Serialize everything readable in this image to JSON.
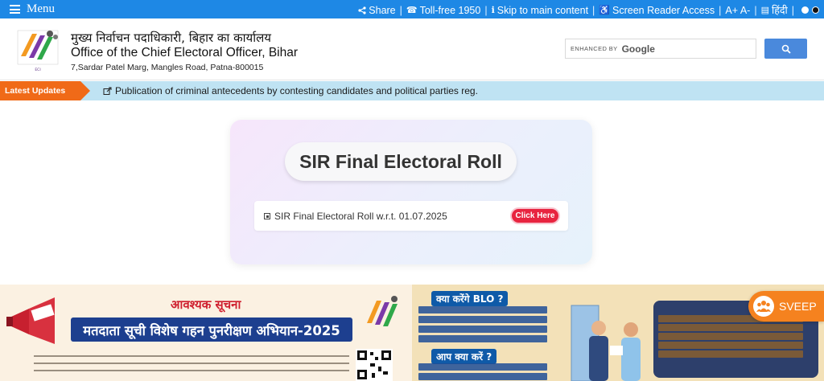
{
  "topbar": {
    "menu_label": "Menu",
    "share": "Share",
    "tollfree": "Toll-free 1950",
    "skip": "Skip to main content",
    "screen_reader": "Screen Reader Access",
    "text_size": "A+ A-",
    "language": "हिंदी",
    "bg_color": "#1e88e5"
  },
  "header": {
    "hindi_title": "मुख्य निर्वाचन पदाधिकारी, बिहार का कार्यालय",
    "english_title": "Office of the Chief Electoral Officer, Bihar",
    "address": "7,Sardar Patel Marg, Mangles Road, Patna-800015",
    "search_enhanced": "ENHANCED BY",
    "search_brand": "Google",
    "search_placeholder": ""
  },
  "updates": {
    "label": "Latest Updates",
    "text": "Publication of criminal antecedents by contesting candidates and political parties reg.",
    "accent": "#f06a18"
  },
  "card": {
    "title": "SIR Final Electoral Roll",
    "item_text": "SIR Final Electoral Roll w.r.t. 01.07.2025",
    "button_label": "Click Here"
  },
  "banner": {
    "notice_title": "आवश्यक सूचना",
    "notice_heading": "मतदाता सूची विशेष गहन पुनरीक्षण अभियान-2025",
    "blo_question": "क्या करेंगे BLO ?",
    "your_question": "आप क्या करें ?"
  },
  "sveep": {
    "label": "SVEEP"
  }
}
